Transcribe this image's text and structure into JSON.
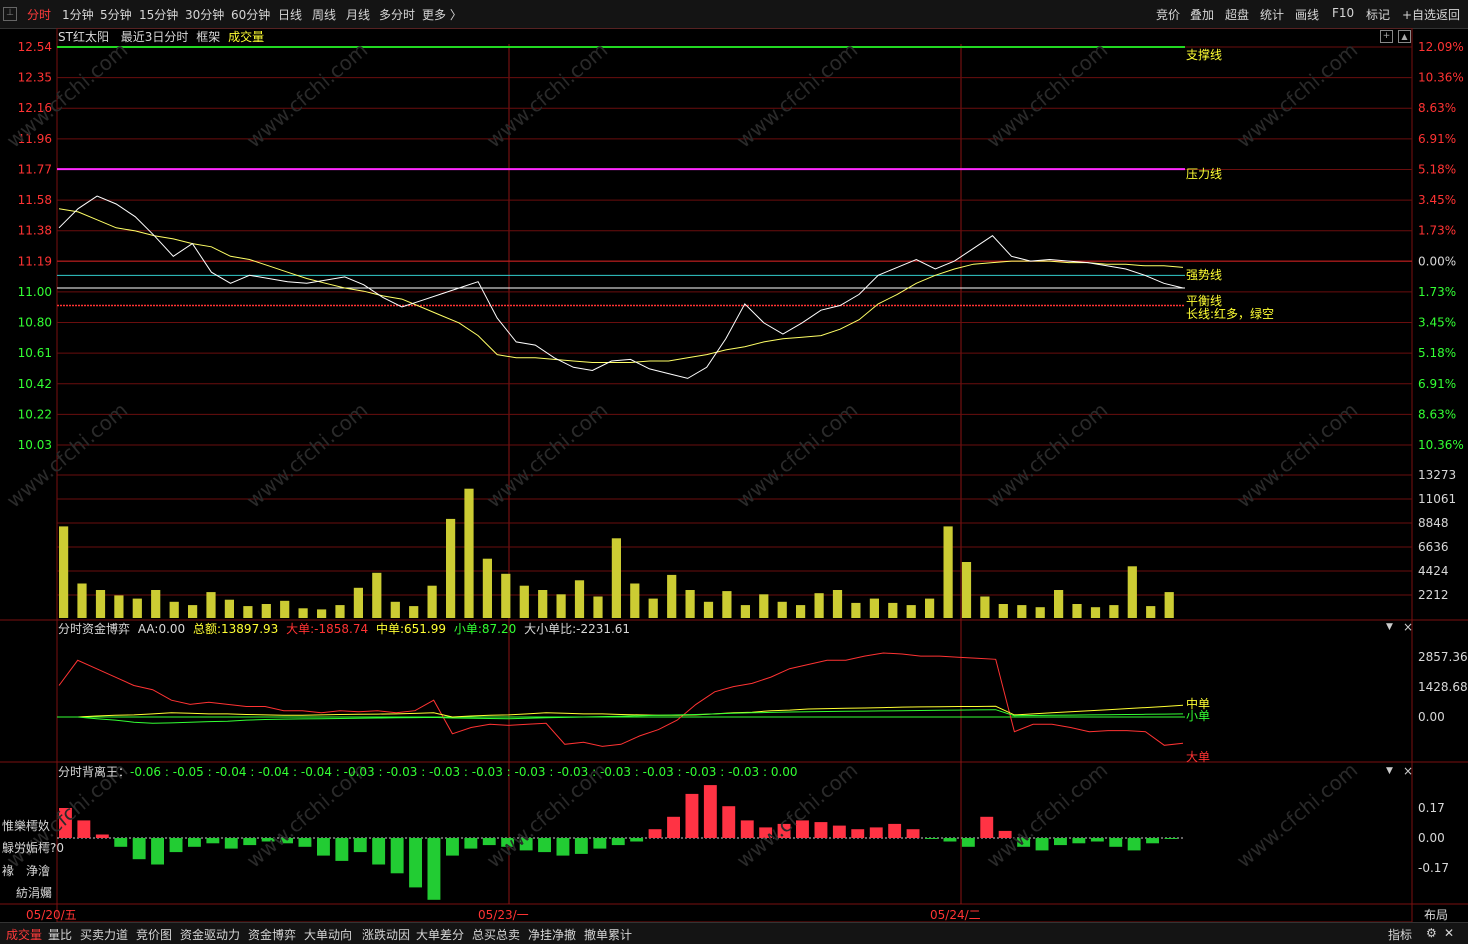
{
  "top_tabs": [
    "分时",
    "1分钟",
    "5分钟",
    "15分钟",
    "30分钟",
    "60分钟",
    "日线",
    "周线",
    "月线",
    "多分时",
    "更多 〉"
  ],
  "top_right_buttons": [
    "竞价",
    "叠加",
    "超盘",
    "统计",
    "画线",
    "F10",
    "标记",
    "+自选",
    "返回"
  ],
  "price_panel": {
    "stock_name": "ST红太阳",
    "mode": "最近3日分时",
    "frame_label": "框架",
    "volume_label": "成交量",
    "left_ticks": [
      "12.54",
      "12.35",
      "12.16",
      "11.96",
      "11.77",
      "11.58",
      "11.38",
      "11.19",
      "11.00",
      "10.80",
      "10.61",
      "10.42",
      "10.22",
      "10.03"
    ],
    "right_ticks": [
      "12.09%",
      "10.36%",
      "8.63%",
      "6.91%",
      "5.18%",
      "3.45%",
      "1.73%",
      "0.00%",
      "1.73%",
      "3.45%",
      "5.18%",
      "6.91%",
      "8.63%",
      "10.36%"
    ],
    "lines": {
      "support": "支撑线",
      "pressure": "压力线",
      "strong": "强势线",
      "balance": "平衡线",
      "long": "长线:红多，绿空"
    },
    "colors": {
      "support": "#22d822",
      "pressure": "#ff2bff",
      "strong": "#33cccc",
      "balance": "#ffffff",
      "long": "#ff3333",
      "price": "#ffffff",
      "avg": "#ffff66"
    }
  },
  "volume_panel": {
    "right_ticks": [
      "13273",
      "11061",
      "8848",
      "6636",
      "4424",
      "2212"
    ],
    "bar_color": "#cccc33"
  },
  "fund_panel": {
    "title": "分时资金博弈",
    "aa_label": "AA:",
    "aa_value": "0.00",
    "total_label": "总额:",
    "total_value": "13897.93",
    "big_label": "大单:",
    "big_value": "-1858.74",
    "mid_label": "中单:",
    "mid_value": "651.99",
    "small_label": "小单:",
    "small_value": "87.20",
    "ratio_label": "大小单比:",
    "ratio_value": "-2231.61",
    "right_ticks": [
      "2857.36",
      "1428.68",
      "0.00"
    ],
    "legend": {
      "mid": "中单",
      "small": "小单",
      "big": "大单"
    }
  },
  "div_panel": {
    "title": "分时背离王：",
    "values": "-0.06 : -0.05 : -0.04 : -0.04 : -0.04 : -0.03 : -0.03 : -0.03 : -0.03 : -0.03 : -0.03 : -0.03 : -0.03 : -0.03 : -0.03 : 0.00",
    "right_ticks": [
      "0.17",
      "0.00",
      "-0.17"
    ],
    "side_labels": [
      "惟樂樗奺",
      "鵦労姤樗?0",
      "褖",
      "浄澮",
      "紡涓孎"
    ]
  },
  "dates": [
    "05/20/五",
    "05/23/一",
    "05/24/二"
  ],
  "layout_button": "布局",
  "bottom_tabs": [
    "成交量",
    "量比",
    "买卖力道",
    "竞价图",
    "资金驱动力",
    "资金博弈",
    "大单动向",
    "涨跌动因",
    "大单差分",
    "总买总卖",
    "净挂净撤",
    "撤单累计"
  ],
  "bottom_right": {
    "indicator": "指标"
  },
  "watermark": "www.cfchi.com",
  "chart_data": [
    {
      "type": "line",
      "title": "ST红太阳 最近3日分时",
      "y_left_ticks": [
        12.54,
        12.35,
        12.16,
        11.96,
        11.77,
        11.58,
        11.38,
        11.19,
        11.0,
        10.8,
        10.61,
        10.42,
        10.22,
        10.03
      ],
      "ylim": [
        10.03,
        12.54
      ],
      "levels": {
        "support": 12.54,
        "pressure": 11.77,
        "strong": 11.1,
        "balance": 11.02,
        "long": 10.91
      },
      "days": [
        "05/20/五",
        "05/23/一",
        "05/24/二"
      ],
      "series": [
        {
          "name": "price",
          "values": [
            11.4,
            11.52,
            11.6,
            11.55,
            11.47,
            11.35,
            11.22,
            11.3,
            11.12,
            11.05,
            11.1,
            11.08,
            11.06,
            11.05,
            11.07,
            11.09,
            11.04,
            10.96,
            10.9,
            10.94,
            10.98,
            11.02,
            11.06,
            10.83,
            10.68,
            10.66,
            10.58,
            10.52,
            10.5,
            10.56,
            10.57,
            10.51,
            10.48,
            10.45,
            10.52,
            10.7,
            10.92,
            10.8,
            10.73,
            10.8,
            10.88,
            10.91,
            10.98,
            11.1,
            11.15,
            11.2,
            11.14,
            11.19,
            11.27,
            11.35,
            11.22,
            11.19,
            11.2,
            11.19,
            11.18,
            11.16,
            11.14,
            11.1,
            11.05,
            11.02
          ]
        },
        {
          "name": "avg",
          "values": [
            11.52,
            11.5,
            11.45,
            11.4,
            11.38,
            11.35,
            11.33,
            11.3,
            11.28,
            11.22,
            11.2,
            11.16,
            11.12,
            11.08,
            11.05,
            11.02,
            11.0,
            10.97,
            10.95,
            10.9,
            10.85,
            10.8,
            10.72,
            10.6,
            10.58,
            10.58,
            10.57,
            10.56,
            10.55,
            10.55,
            10.55,
            10.56,
            10.56,
            10.58,
            10.6,
            10.63,
            10.65,
            10.68,
            10.7,
            10.71,
            10.72,
            10.76,
            10.82,
            10.92,
            10.98,
            11.05,
            11.1,
            11.14,
            11.17,
            11.18,
            11.19,
            11.19,
            11.19,
            11.18,
            11.18,
            11.17,
            11.17,
            11.16,
            11.16,
            11.15
          ]
        }
      ]
    },
    {
      "type": "bar",
      "title": "成交量",
      "y_ticks": [
        2212,
        4424,
        6636,
        8848,
        11061,
        13273
      ],
      "ylim": [
        0,
        13273
      ],
      "values": [
        8500,
        3200,
        2600,
        2100,
        1800,
        2600,
        1500,
        1200,
        2400,
        1700,
        1100,
        1300,
        1600,
        900,
        800,
        1200,
        2800,
        4200,
        1500,
        1100,
        3000,
        9200,
        12000,
        5500,
        4100,
        3000,
        2600,
        2200,
        3500,
        2000,
        7400,
        3200,
        1800,
        4000,
        2600,
        1500,
        2500,
        1200,
        2200,
        1500,
        1200,
        2300,
        2600,
        1400,
        1800,
        1400,
        1200,
        1800,
        8500,
        5200,
        2000,
        1300,
        1200,
        1000,
        2600,
        1300,
        1000,
        1200,
        4800,
        1100,
        2400
      ]
    },
    {
      "type": "line",
      "title": "分时资金博弈",
      "y_ticks": [
        2857.36,
        1428.68,
        0.0
      ],
      "series": [
        {
          "name": "大单",
          "values": [
            1500,
            2700,
            2300,
            1900,
            1500,
            1300,
            800,
            600,
            700,
            600,
            500,
            500,
            300,
            300,
            200,
            300,
            250,
            300,
            200,
            300,
            800,
            -800,
            -500,
            -350,
            -400,
            -350,
            -300,
            -1300,
            -1200,
            -1400,
            -1300,
            -900,
            -600,
            -150,
            600,
            1200,
            1450,
            1600,
            1900,
            2300,
            2500,
            2700,
            2700,
            2900,
            3050,
            3000,
            2900,
            2900,
            2850,
            2800,
            2750,
            -700,
            -350,
            -350,
            -500,
            -700,
            -650,
            -650,
            -700,
            -1350,
            -1250
          ]
        },
        {
          "name": "中单",
          "values": [
            0,
            0,
            50,
            80,
            100,
            150,
            200,
            180,
            150,
            150,
            120,
            100,
            80,
            80,
            100,
            120,
            130,
            140,
            150,
            170,
            200,
            0,
            50,
            80,
            100,
            150,
            200,
            180,
            150,
            150,
            120,
            100,
            80,
            80,
            100,
            150,
            200,
            230,
            300,
            330,
            380,
            400,
            420,
            430,
            450,
            470,
            480,
            490,
            500,
            500,
            510,
            100,
            150,
            200,
            250,
            300,
            350,
            400,
            450,
            500,
            560
          ]
        },
        {
          "name": "小单",
          "values": [
            0,
            0,
            -80,
            -150,
            -250,
            -300,
            -280,
            -250,
            -220,
            -200,
            -150,
            -120,
            -100,
            -90,
            -80,
            -70,
            -60,
            -50,
            -40,
            -30,
            -20,
            -50,
            -60,
            -70,
            -80,
            -60,
            -40,
            -20,
            0,
            20,
            40,
            60,
            80,
            100,
            120,
            150,
            180,
            200,
            220,
            240,
            250,
            260,
            270,
            280,
            290,
            300,
            310,
            320,
            330,
            340,
            350,
            60,
            70,
            80,
            90,
            100,
            110,
            120,
            130,
            140,
            150
          ]
        }
      ]
    },
    {
      "type": "bar",
      "title": "分时背离王",
      "y_ticks": [
        0.17,
        0.0,
        -0.17
      ],
      "values": [
        0.17,
        0.1,
        0.02,
        -0.05,
        -0.12,
        -0.15,
        -0.08,
        -0.05,
        -0.03,
        -0.06,
        -0.04,
        -0.02,
        -0.03,
        -0.05,
        -0.1,
        -0.13,
        -0.08,
        -0.15,
        -0.2,
        -0.28,
        -0.35,
        -0.1,
        -0.06,
        -0.04,
        -0.05,
        -0.07,
        -0.08,
        -0.1,
        -0.09,
        -0.06,
        -0.04,
        -0.02,
        0.05,
        0.12,
        0.25,
        0.3,
        0.18,
        0.1,
        0.06,
        0.08,
        0.1,
        0.09,
        0.07,
        0.05,
        0.06,
        0.08,
        0.05,
        0.0,
        -0.02,
        -0.05,
        0.12,
        0.04,
        -0.05,
        -0.07,
        -0.04,
        -0.03,
        -0.02,
        -0.05,
        -0.07,
        -0.03,
        0.0
      ]
    }
  ]
}
